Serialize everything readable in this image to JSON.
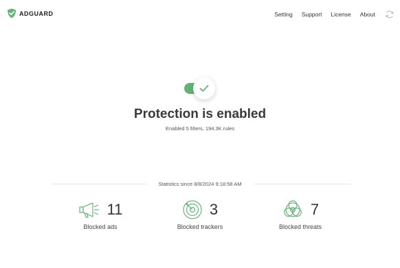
{
  "app": {
    "logo_text": "ADGUARD"
  },
  "nav": {
    "items": [
      "Setting",
      "Support",
      "License",
      "About"
    ]
  },
  "protection": {
    "enabled": true,
    "title": "Protection is enabled",
    "subtitle": "Enabled 5 filters, 194.3K rules"
  },
  "stats": {
    "since_label": "Statistics since 8/8/2024 9:18:58 AM",
    "items": [
      {
        "value": "11",
        "label": "Blocked ads",
        "icon": "megaphone-icon"
      },
      {
        "value": "3",
        "label": "Blocked trackers",
        "icon": "radar-icon"
      },
      {
        "value": "7",
        "label": "Blocked threats",
        "icon": "biohazard-icon"
      }
    ]
  },
  "colors": {
    "accent": "#67b279",
    "text": "#333333"
  }
}
